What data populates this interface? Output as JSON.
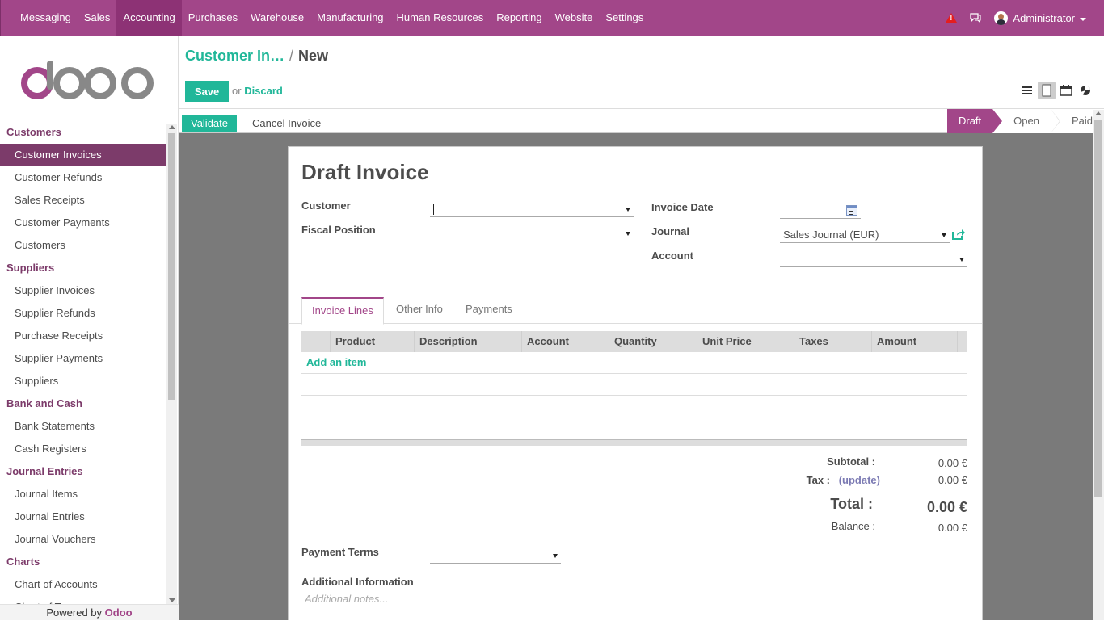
{
  "topnav": {
    "items": [
      {
        "label": "Messaging"
      },
      {
        "label": "Sales"
      },
      {
        "label": "Accounting"
      },
      {
        "label": "Purchases"
      },
      {
        "label": "Warehouse"
      },
      {
        "label": "Manufacturing"
      },
      {
        "label": "Human Resources"
      },
      {
        "label": "Reporting"
      },
      {
        "label": "Website"
      },
      {
        "label": "Settings"
      }
    ],
    "active": "Accounting",
    "warning_badge": "!",
    "user": "Administrator"
  },
  "sidebar": {
    "sections": [
      {
        "title": "Customers",
        "items": [
          "Customer Invoices",
          "Customer Refunds",
          "Sales Receipts",
          "Customer Payments",
          "Customers"
        ]
      },
      {
        "title": "Suppliers",
        "items": [
          "Supplier Invoices",
          "Supplier Refunds",
          "Purchase Receipts",
          "Supplier Payments",
          "Suppliers"
        ]
      },
      {
        "title": "Bank and Cash",
        "items": [
          "Bank Statements",
          "Cash Registers"
        ]
      },
      {
        "title": "Journal Entries",
        "items": [
          "Journal Items",
          "Journal Entries",
          "Journal Vouchers"
        ]
      },
      {
        "title": "Charts",
        "items": [
          "Chart of Accounts",
          "Chart of Taxes"
        ]
      }
    ],
    "active_item": "Customer Invoices",
    "powered_prefix": "Powered by",
    "powered_brand": "Odoo"
  },
  "header": {
    "breadcrumb_parent": "Customer In…",
    "breadcrumb_sep": "/",
    "breadcrumb_current": "New",
    "save_label": "Save",
    "or_text": "or",
    "discard_label": "Discard"
  },
  "statusbar": {
    "validate_label": "Validate",
    "cancel_label": "Cancel Invoice",
    "stages": [
      "Draft",
      "Open",
      "Paid"
    ],
    "active_stage": "Draft"
  },
  "form": {
    "title": "Draft Invoice",
    "customer_label": "Customer",
    "customer_value": "",
    "fiscal_label": "Fiscal Position",
    "fiscal_value": "",
    "invoice_date_label": "Invoice Date",
    "invoice_date_value": "",
    "journal_label": "Journal",
    "journal_value": "Sales Journal (EUR)",
    "account_label": "Account",
    "account_value": "",
    "tabs": [
      "Invoice Lines",
      "Other Info",
      "Payments"
    ],
    "active_tab": "Invoice Lines",
    "columns": [
      "Product",
      "Description",
      "Account",
      "Quantity",
      "Unit Price",
      "Taxes",
      "Amount"
    ],
    "add_item_label": "Add an item",
    "subtotal_label": "Subtotal :",
    "subtotal_value": "0.00 €",
    "tax_label": "Tax :",
    "tax_update": "(update)",
    "tax_value": "0.00 €",
    "total_label": "Total :",
    "total_value": "0.00 €",
    "balance_label": "Balance :",
    "balance_value": "0.00 €",
    "payment_terms_label": "Payment Terms",
    "payment_terms_value": "",
    "additional_info_label": "Additional Information",
    "notes_placeholder": "Additional notes..."
  },
  "colors": {
    "brand": "#a24689",
    "accent": "#21b799",
    "sidebar_active": "#7c3b6a"
  }
}
